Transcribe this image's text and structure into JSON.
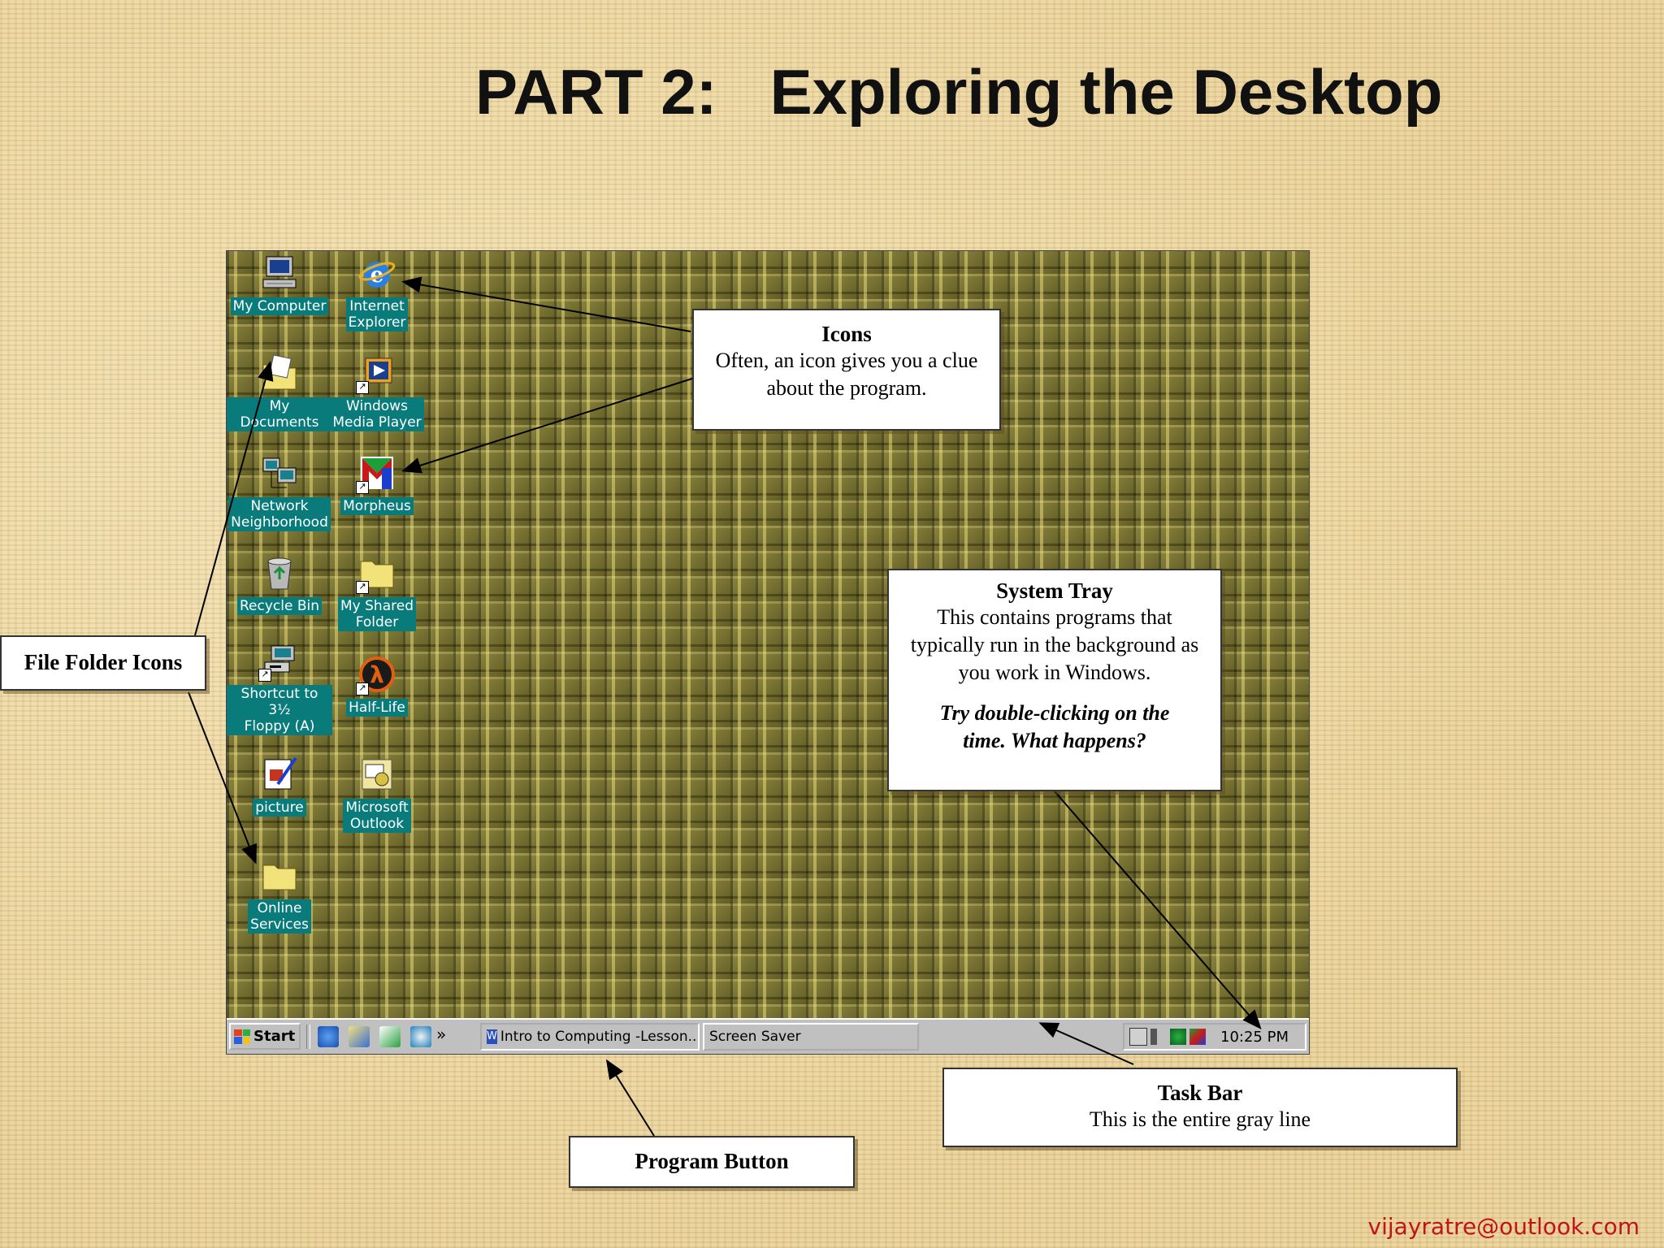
{
  "slide": {
    "title": "PART 2:   Exploring the Desktop",
    "footer_email": "vijayratre@outlook.com"
  },
  "desktop_icons": [
    {
      "name": "my-computer",
      "label": "My Computer",
      "icon": "computer-icon"
    },
    {
      "name": "internet-explorer",
      "label": "Internet\nExplorer",
      "icon": "ie-icon"
    },
    {
      "name": "my-documents",
      "label": "My Documents",
      "icon": "documents-folder-icon"
    },
    {
      "name": "windows-media-player",
      "label": "Windows\nMedia Player",
      "icon": "media-player-icon"
    },
    {
      "name": "network-neighborhood",
      "label": "Network\nNeighborhood",
      "icon": "network-icon"
    },
    {
      "name": "morpheus",
      "label": "Morpheus",
      "icon": "morpheus-icon"
    },
    {
      "name": "recycle-bin",
      "label": "Recycle Bin",
      "icon": "recycle-bin-icon"
    },
    {
      "name": "my-shared-folder",
      "label": "My Shared\nFolder",
      "icon": "folder-icon"
    },
    {
      "name": "floppy-shortcut",
      "label": "Shortcut to 3½\nFloppy (A)",
      "icon": "floppy-drive-icon"
    },
    {
      "name": "half-life",
      "label": "Half-Life",
      "icon": "half-life-icon"
    },
    {
      "name": "picture",
      "label": "picture",
      "icon": "picture-icon"
    },
    {
      "name": "microsoft-outlook",
      "label": "Microsoft\nOutlook",
      "icon": "outlook-icon"
    },
    {
      "name": "online-services",
      "label": "Online\nServices",
      "icon": "folder-icon"
    }
  ],
  "taskbar": {
    "start_label": "Start",
    "quick_launch": [
      "ie-icon",
      "outlook-express-icon",
      "desktop-icon",
      "channels-icon"
    ],
    "overflow": "»",
    "task_buttons": [
      "Intro to Computing -Lesson...",
      "Screen Saver"
    ],
    "clock": "10:25 PM",
    "tray_icons": [
      "tray-monitor-icon",
      "volume-icon",
      "network-tray-icon",
      "morpheus-tray-icon"
    ]
  },
  "callouts": {
    "icons": {
      "title": "Icons",
      "body": "Often,  an icon gives you a clue about the program."
    },
    "system_tray": {
      "title": "System Tray",
      "body": "This contains programs that typically run  in the background as you work in Windows.",
      "italic": "Try double-clicking on the time.  What happens?"
    },
    "file_folder": {
      "title": "File Folder Icons"
    },
    "task_bar": {
      "title": "Task Bar",
      "body": "This is the entire gray line"
    },
    "program_button": {
      "title": "Program Button"
    }
  },
  "colors": {
    "slide_background": "#ecd6a0",
    "icon_label_bg": "#0a7b7b",
    "taskbar": "#c0c0c0",
    "footer_text": "#c0141a"
  }
}
